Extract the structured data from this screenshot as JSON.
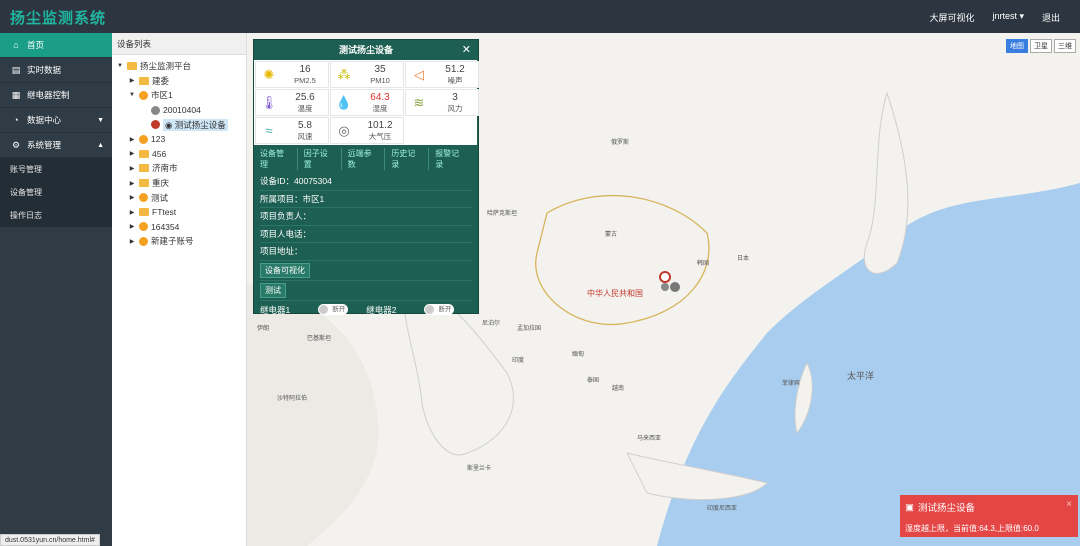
{
  "app": {
    "title": "扬尘监测系统"
  },
  "topbar": {
    "bigscreen": "大屏可视化",
    "user": "jnrtest ▾",
    "logout": "退出"
  },
  "sidebar": {
    "items": [
      {
        "label": "首页",
        "icon": "home-icon",
        "glyph": "⌂"
      },
      {
        "label": "实时数据",
        "icon": "chart-icon",
        "glyph": "▤"
      },
      {
        "label": "继电器控制",
        "icon": "relay-icon",
        "glyph": "▦"
      },
      {
        "label": "数据中心",
        "icon": "data-icon",
        "glyph": "◔",
        "caret": "▼"
      },
      {
        "label": "系统管理",
        "icon": "gear-icon",
        "glyph": "⚙",
        "caret": "▲"
      }
    ],
    "subitems": [
      {
        "label": "账号管理"
      },
      {
        "label": "设备管理"
      },
      {
        "label": "操作日志"
      }
    ]
  },
  "tree": {
    "header": "设备列表",
    "nodes": [
      {
        "label": "扬尘监测平台"
      },
      {
        "label": "建委"
      },
      {
        "label": "市区1"
      },
      {
        "label": "20010404"
      },
      {
        "label": "测试扬尘设备"
      },
      {
        "label": "123"
      },
      {
        "label": "456"
      },
      {
        "label": "济南市"
      },
      {
        "label": "重庆"
      },
      {
        "label": "测试"
      },
      {
        "label": "FTtest"
      },
      {
        "label": "164354"
      },
      {
        "label": "新建子账号"
      }
    ]
  },
  "panel": {
    "title": "测试扬尘设备",
    "close": "✕",
    "metrics": [
      {
        "value": "16",
        "label": "PM2.5",
        "icon": "dust-icon",
        "glyph": "✺",
        "color": "#e6b800"
      },
      {
        "value": "35",
        "label": "PM10",
        "icon": "particles-icon",
        "glyph": "⁂",
        "color": "#c9b800"
      },
      {
        "value": "51.2",
        "label": "噪声",
        "icon": "speaker-icon",
        "glyph": "◁",
        "color": "#f08030"
      },
      {
        "value": "25.6",
        "label": "温度",
        "icon": "thermometer-icon",
        "glyph": "🌡",
        "color": "#7a4fd0"
      },
      {
        "value": "64.3",
        "label": "湿度",
        "icon": "droplet-icon",
        "glyph": "💧",
        "color": "#2a88d8",
        "alert": true
      },
      {
        "value": "3",
        "label": "风力",
        "icon": "wind-icon",
        "glyph": "≋",
        "color": "#8aa040"
      },
      {
        "value": "5.8",
        "label": "风速",
        "icon": "windspeed-icon",
        "glyph": "≈",
        "color": "#40b0a8"
      },
      {
        "value": "101.2",
        "label": "大气压",
        "icon": "pressure-icon",
        "glyph": "◎",
        "color": "#666666"
      }
    ],
    "tabs": [
      {
        "label": "设备管理"
      },
      {
        "label": "因子设置"
      },
      {
        "label": "远端参数"
      },
      {
        "label": "历史记录"
      },
      {
        "label": "报警记录"
      }
    ],
    "info": [
      {
        "label": "设备ID：",
        "value": "40075304"
      },
      {
        "label": "所属项目：",
        "value": "市区1"
      },
      {
        "label": "项目负责人：",
        "value": ""
      },
      {
        "label": "项目人电话：",
        "value": ""
      },
      {
        "label": "项目地址：",
        "value": ""
      }
    ],
    "visual_button": "设备可视化",
    "test_button": "测试",
    "relays": [
      {
        "label": "继电器1",
        "state": "断开"
      },
      {
        "label": "继电器2",
        "state": "断开"
      }
    ]
  },
  "map": {
    "tabs": [
      {
        "label": "地图",
        "active": true
      },
      {
        "label": "卫星"
      },
      {
        "label": "三维"
      }
    ],
    "labels": [
      "俄罗斯",
      "哈萨克斯坦",
      "蒙古",
      "中华人民共和国",
      "印度",
      "缅甸",
      "泰国",
      "越南",
      "菲律宾",
      "太平洋",
      "日本",
      "韩国",
      "巴基斯坦",
      "伊朗",
      "沙特阿拉伯",
      "马来西亚",
      "印度尼西亚",
      "斯里兰卡",
      "孟加拉国",
      "尼泊尔"
    ]
  },
  "toast": {
    "title": "测试扬尘设备",
    "message": "湿度越上限，当前值:64.3,上限值:60.0",
    "close": "×"
  },
  "statusbar": {
    "url": "dust.0531yun.cn/home.html#"
  }
}
